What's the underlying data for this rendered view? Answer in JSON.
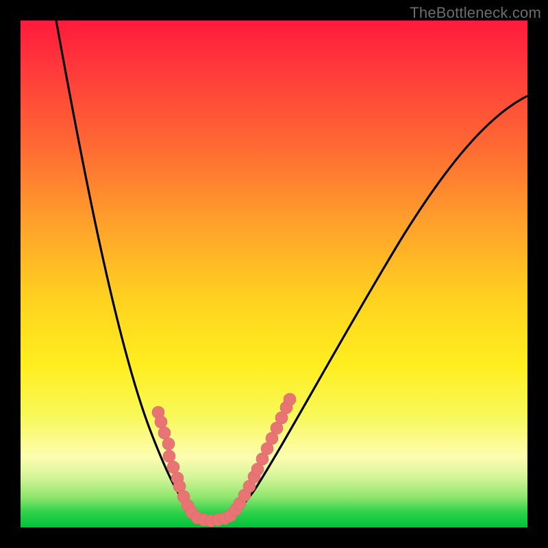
{
  "watermark": "TheBottleneck.com",
  "colors": {
    "frame_bg": "#000000",
    "curve_stroke": "#000000",
    "marker_fill": "#e97474",
    "gradient_top": "#ff1a3c",
    "gradient_bottom": "#00c23a"
  },
  "chart_data": {
    "type": "line",
    "title": "",
    "xlabel": "",
    "ylabel": "",
    "xlim": [
      0,
      100
    ],
    "ylim": [
      0,
      100
    ],
    "note": "No axis ticks or numeric labels are rendered in the image; values below are read off by normalized pixel position within the 740×740 plot area (x: 0–100 left→right, y: 0–100 bottom→top).",
    "series": [
      {
        "name": "bottleneck-curve",
        "x": [
          7,
          12,
          19,
          26,
          34,
          38,
          43,
          47,
          54,
          63,
          75,
          88,
          100
        ],
        "y": [
          100,
          72,
          37,
          19,
          3,
          1,
          8,
          19,
          37,
          55,
          70,
          81,
          85
        ]
      }
    ],
    "markers": {
      "name": "highlighted-points",
      "approx_x_range": [
        27,
        53
      ],
      "approx_y_range": [
        1,
        26
      ],
      "count": 29,
      "points": [
        {
          "x": 27,
          "y": 23
        },
        {
          "x": 28,
          "y": 21
        },
        {
          "x": 28,
          "y": 19
        },
        {
          "x": 29,
          "y": 17
        },
        {
          "x": 29,
          "y": 14
        },
        {
          "x": 30,
          "y": 12
        },
        {
          "x": 31,
          "y": 10
        },
        {
          "x": 31,
          "y": 8
        },
        {
          "x": 32,
          "y": 6
        },
        {
          "x": 33,
          "y": 4
        },
        {
          "x": 34,
          "y": 3
        },
        {
          "x": 35,
          "y": 2
        },
        {
          "x": 36,
          "y": 1
        },
        {
          "x": 38,
          "y": 1
        },
        {
          "x": 39,
          "y": 1
        },
        {
          "x": 40,
          "y": 2
        },
        {
          "x": 41,
          "y": 2
        },
        {
          "x": 42,
          "y": 4
        },
        {
          "x": 43,
          "y": 5
        },
        {
          "x": 44,
          "y": 6
        },
        {
          "x": 45,
          "y": 8
        },
        {
          "x": 46,
          "y": 10
        },
        {
          "x": 47,
          "y": 12
        },
        {
          "x": 48,
          "y": 14
        },
        {
          "x": 49,
          "y": 16
        },
        {
          "x": 50,
          "y": 18
        },
        {
          "x": 51,
          "y": 20
        },
        {
          "x": 52,
          "y": 22
        },
        {
          "x": 53,
          "y": 25
        }
      ]
    }
  }
}
